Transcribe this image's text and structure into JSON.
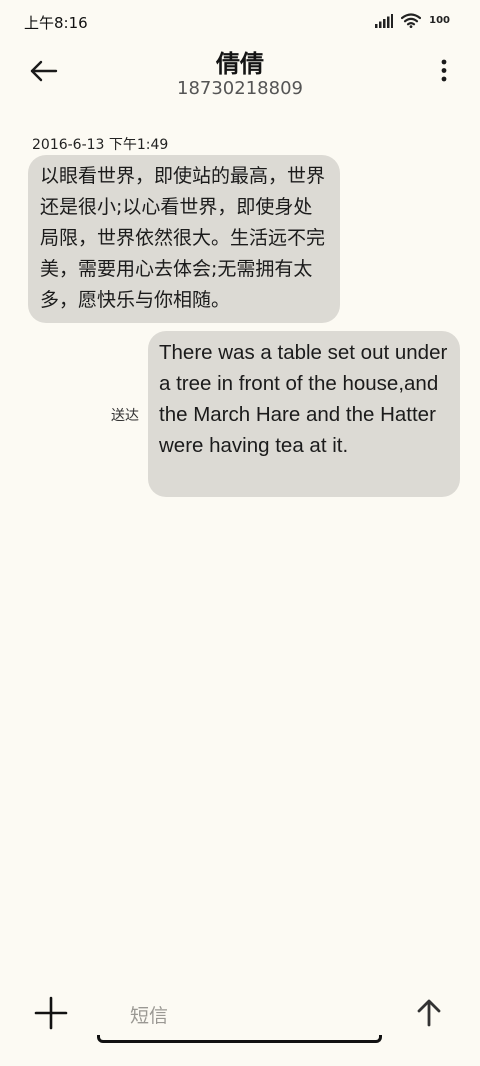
{
  "status_bar": {
    "time": "上午8:16",
    "battery": "100",
    "icons": [
      "signal-icon",
      "wifi-icon",
      "battery-icon"
    ]
  },
  "header": {
    "back_icon": "arrow-left-icon",
    "contact_name": "倩倩",
    "contact_number": "18730218809",
    "more_icon": "more-vert-icon"
  },
  "conversation": {
    "timestamp": "2016-6-13 下午1:49",
    "messages": [
      {
        "direction": "incoming",
        "text": "以眼看世界，即使站的最高，世界还是很小;以心看世界，即使身处局限，世界依然很大。生活远不完美，需要用心去体会;无需拥有太多，愿快乐与你相随。"
      },
      {
        "direction": "outgoing",
        "text": "There was a table set out under a tree in front of the house,and the March Hare and the Hatter were having tea at it.",
        "status": "送达"
      }
    ]
  },
  "composer": {
    "attach_icon": "plus-icon",
    "placeholder": "短信",
    "value": "",
    "send_icon": "arrow-up-icon"
  },
  "colors": {
    "background": "#fcfaf3",
    "bubble": "#dcdad4",
    "text": "#1c1c1c"
  }
}
